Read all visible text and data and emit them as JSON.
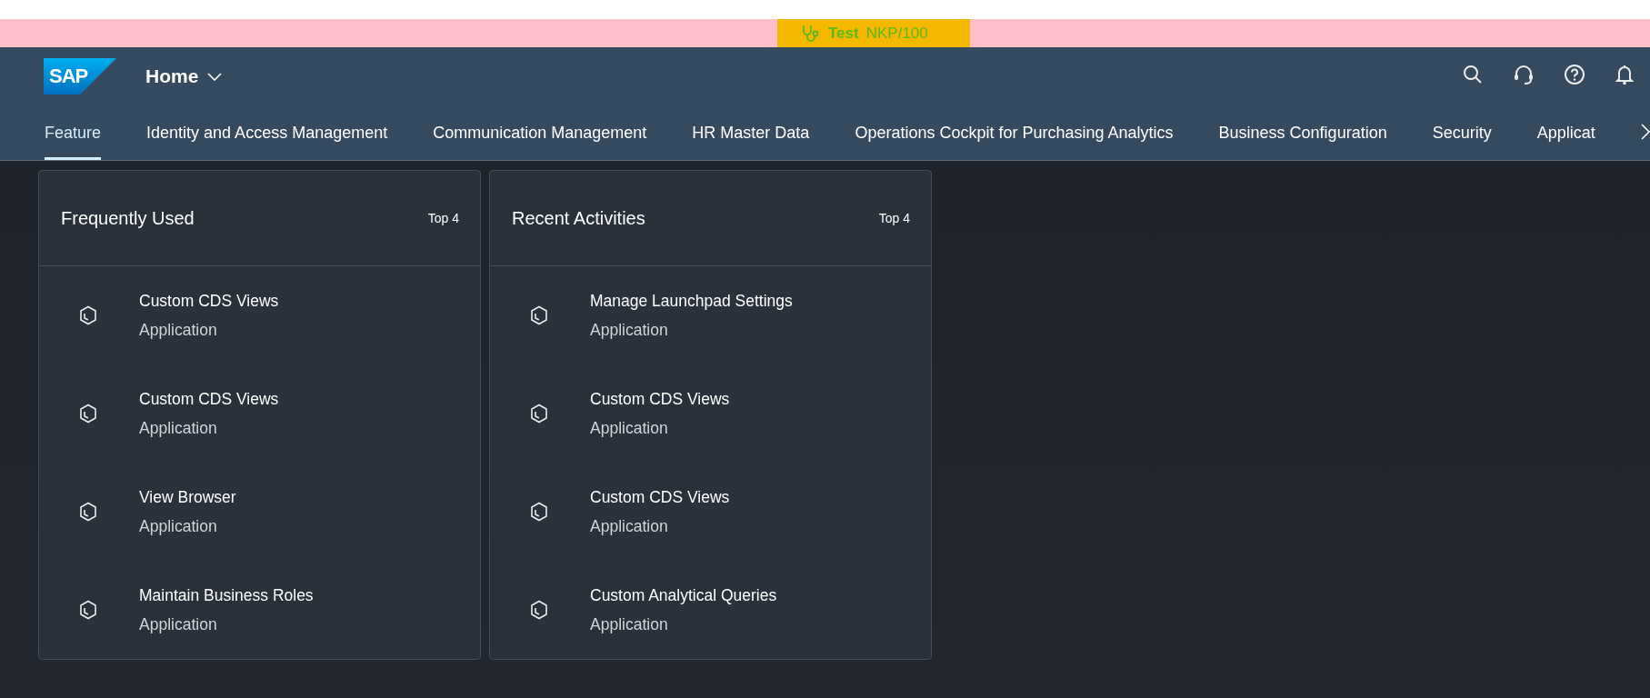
{
  "system_banner": {
    "label": "Test",
    "client": "NKP/100"
  },
  "shell_bar": {
    "logo": "SAP",
    "title": "Home"
  },
  "tabs": [
    {
      "label": "Feature",
      "selected": true
    },
    {
      "label": "Identity and Access Management",
      "selected": false
    },
    {
      "label": "Communication Management",
      "selected": false
    },
    {
      "label": "HR Master Data",
      "selected": false
    },
    {
      "label": "Operations Cockpit for Purchasing Analytics",
      "selected": false
    },
    {
      "label": "Business Configuration",
      "selected": false
    },
    {
      "label": "Security",
      "selected": false
    },
    {
      "label": "Applicat",
      "selected": false
    }
  ],
  "cards": [
    {
      "title": "Frequently Used",
      "count": "Top 4",
      "items": [
        {
          "title": "Custom CDS Views",
          "subtitle": "Application"
        },
        {
          "title": "Custom CDS Views",
          "subtitle": "Application"
        },
        {
          "title": "View Browser",
          "subtitle": "Application"
        },
        {
          "title": "Maintain Business Roles",
          "subtitle": "Application"
        }
      ]
    },
    {
      "title": "Recent Activities",
      "count": "Top 4",
      "items": [
        {
          "title": "Manage Launchpad Settings",
          "subtitle": "Application"
        },
        {
          "title": "Custom CDS Views",
          "subtitle": "Application"
        },
        {
          "title": "Custom CDS Views",
          "subtitle": "Application"
        },
        {
          "title": "Custom Analytical Queries",
          "subtitle": "Application"
        }
      ]
    }
  ]
}
